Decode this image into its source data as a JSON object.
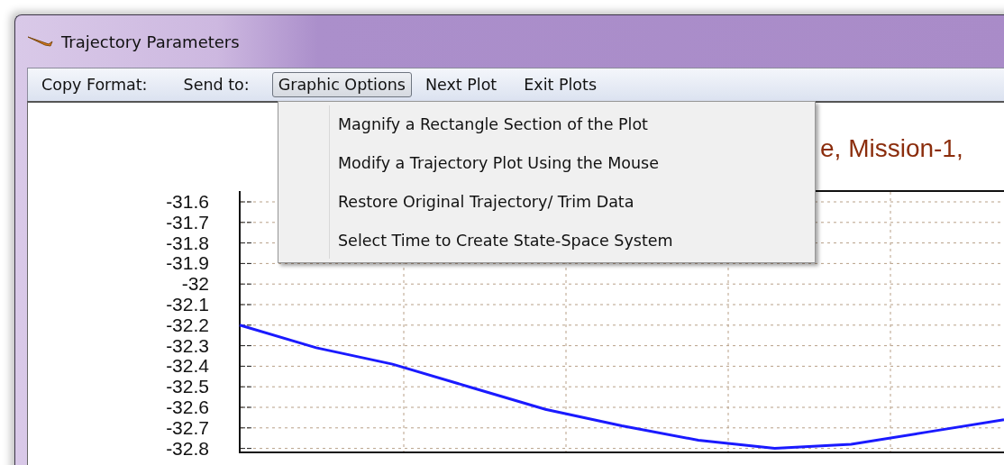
{
  "window": {
    "title": "Trajectory Parameters"
  },
  "menu_bar": [
    {
      "label": "Copy Format:",
      "selected": false
    },
    {
      "label": "Send to:",
      "selected": false
    },
    {
      "label": "Graphic Options",
      "selected": true
    },
    {
      "label": "Next Plot",
      "selected": false
    },
    {
      "label": "Exit Plots",
      "selected": false
    }
  ],
  "dropdown": [
    "Magnify a Rectangle Section of the Plot",
    "Modify a Trajectory Plot Using the Mouse",
    "Restore Original Trajectory/ Trim Data",
    "Select Time to Create State-Space System"
  ],
  "plot": {
    "chart_data": {
      "type": "line",
      "title": "e, Mission-1,",
      "yticks": [
        {
          "value": -31.6,
          "label": "-31.6"
        },
        {
          "value": -31.7,
          "label": "-31.7"
        },
        {
          "value": -31.8,
          "label": "-31.8"
        },
        {
          "value": -31.9,
          "label": "-31.9"
        },
        {
          "value": -32,
          "label": "-32"
        },
        {
          "value": -32.1,
          "label": "-32.1"
        },
        {
          "value": -32.2,
          "label": "-32.2"
        },
        {
          "value": -32.3,
          "label": "-32.3"
        },
        {
          "value": -32.4,
          "label": "-32.4"
        },
        {
          "value": -32.5,
          "label": "-32.5"
        },
        {
          "value": -32.6,
          "label": "-32.6"
        },
        {
          "value": -32.7,
          "label": "-32.7"
        },
        {
          "value": -32.8,
          "label": "-32.8"
        }
      ],
      "ylim": [
        -32.8,
        -31.6
      ],
      "grid": true,
      "series": [
        {
          "color": "#1a1aff",
          "values": [
            -32.2,
            -32.31,
            -32.39,
            -32.5,
            -32.61,
            -32.69,
            -32.76,
            -32.8,
            -32.78,
            -32.72,
            -32.66
          ]
        }
      ]
    }
  }
}
